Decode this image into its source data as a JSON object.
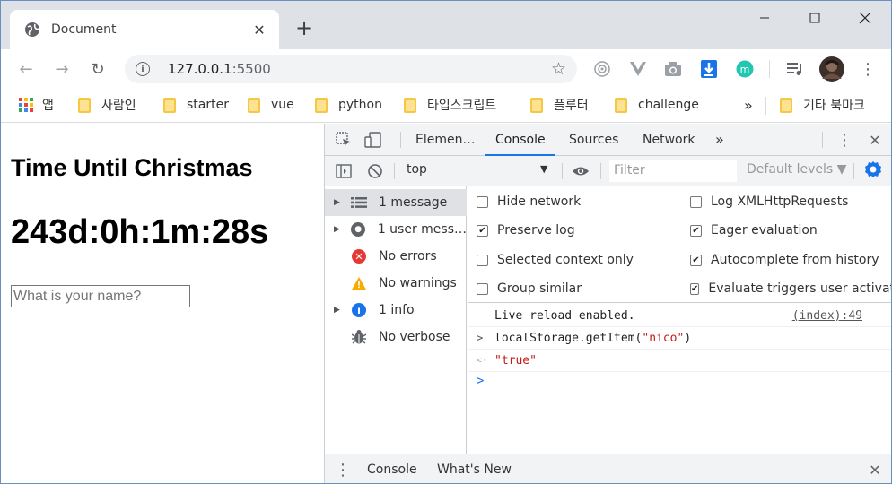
{
  "browser": {
    "tab_title": "Document",
    "new_tab": "+",
    "url_host": "127.0.0.1",
    "url_port": ":5500",
    "back": "←",
    "forward": "→",
    "reload": "↻",
    "info": "i",
    "star": "☆",
    "menu": "⋮",
    "minimize": "—",
    "maximize": "☐",
    "close": "✕",
    "close_tab": "✕"
  },
  "bookmarks": {
    "apps": "앱",
    "items": [
      "사람인",
      "starter",
      "vue",
      "python",
      "타입스크립트",
      "플루터",
      "challenge"
    ],
    "overflow": "»",
    "other": "기타 북마크"
  },
  "page": {
    "heading": "Time Until Christmas",
    "clock": "243d:0h:1m:28s",
    "name_placeholder": "What is your name?"
  },
  "devtools": {
    "tabs": [
      "Elemen…",
      "Console",
      "Sources",
      "Network"
    ],
    "more_tabs": "»",
    "kebab": "⋮",
    "close": "✕",
    "context": "top",
    "context_arrow": "▼",
    "filter_placeholder": "Filter",
    "levels": "Default levels ▼",
    "sidebar": [
      {
        "arrow": "▶",
        "label": "1 message"
      },
      {
        "arrow": "▶",
        "label": "1 user mess…"
      },
      {
        "arrow": "",
        "label": "No errors"
      },
      {
        "arrow": "",
        "label": "No warnings"
      },
      {
        "arrow": "▶",
        "label": "1 info"
      },
      {
        "arrow": "",
        "label": "No verbose"
      }
    ],
    "settings": {
      "left": [
        {
          "label": "Hide network",
          "checked": false
        },
        {
          "label": "Preserve log",
          "checked": true
        },
        {
          "label": "Selected context only",
          "checked": false
        },
        {
          "label": "Group similar",
          "checked": false
        }
      ],
      "right": [
        {
          "label": "Log XMLHttpRequests",
          "checked": false
        },
        {
          "label": "Eager evaluation",
          "checked": true
        },
        {
          "label": "Autocomplete from history",
          "checked": true
        },
        {
          "label": "Evaluate triggers user activatio",
          "checked": true
        }
      ]
    },
    "log": {
      "line1_text": "Live reload enabled.",
      "line1_src": "(index):49",
      "input_prompt": ">",
      "input_prefix": "localStorage.getItem(",
      "input_arg": "\"nico\"",
      "input_suffix": ")",
      "result_prompt": "<·",
      "result": "\"true\"",
      "cursor_prompt": ">"
    },
    "drawer": {
      "kebab": "⋮",
      "tabs": [
        "Console",
        "What's New"
      ],
      "close": "✕"
    }
  }
}
